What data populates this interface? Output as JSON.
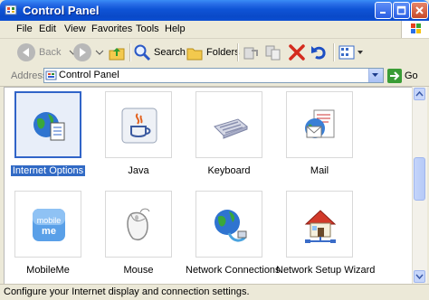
{
  "window": {
    "title": "Control Panel"
  },
  "menu": {
    "items": [
      "File",
      "Edit",
      "View",
      "Favorites",
      "Tools",
      "Help"
    ]
  },
  "toolbar": {
    "back": "Back",
    "search": "Search",
    "folders": "Folders",
    "go": "Go"
  },
  "address": {
    "label": "Address",
    "value": "Control Panel"
  },
  "items": [
    {
      "label": "Internet Options",
      "icon": "globe-document-icon",
      "selected": true
    },
    {
      "label": "Java",
      "icon": "java-cup-icon"
    },
    {
      "label": "Keyboard",
      "icon": "keyboard-icon"
    },
    {
      "label": "Mail",
      "icon": "mail-icon"
    },
    {
      "label": "MobileMe",
      "icon": "mobileme-icon"
    },
    {
      "label": "Mouse",
      "icon": "mouse-icon"
    },
    {
      "label": "Network Connections",
      "icon": "network-globe-icon"
    },
    {
      "label": "Network Setup Wizard",
      "icon": "house-network-icon"
    }
  ],
  "mobileme_icon_text": [
    "mobile",
    "me"
  ],
  "status": {
    "text": "Configure your Internet display and connection settings."
  },
  "colors": {
    "titlebar": "#0a49c8",
    "selection": "#316ac5",
    "accent_green": "#3a9c35"
  }
}
